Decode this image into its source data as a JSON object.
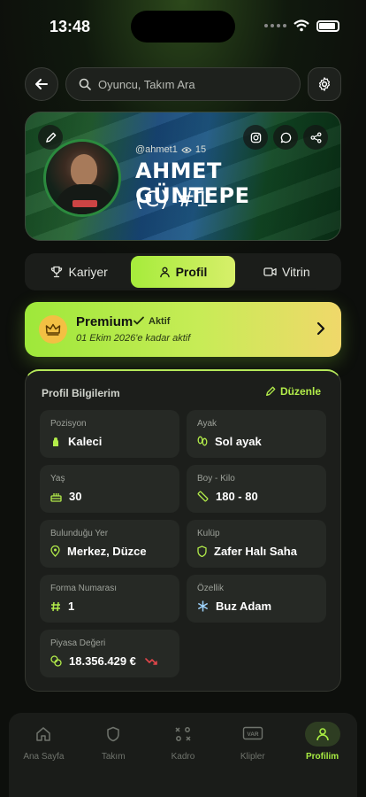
{
  "status_bar": {
    "time": "13:48"
  },
  "search": {
    "placeholder": "Oyuncu, Takım Ara"
  },
  "profile": {
    "handle": "@ahmet1",
    "views": "15",
    "name": "AHMET GÜNTEPE",
    "number_line": "(C) #1"
  },
  "tabs": [
    {
      "label": "Kariyer",
      "icon": "trophy-icon"
    },
    {
      "label": "Profil",
      "icon": "user-icon",
      "active": true
    },
    {
      "label": "Vitrin",
      "icon": "video-icon"
    }
  ],
  "premium": {
    "title": "Premium",
    "status": "Aktif",
    "subtitle": "01 Ekim 2026'e kadar aktif"
  },
  "profile_info": {
    "title": "Profil Bilgilerim",
    "edit_label": "Düzenle",
    "fields": [
      {
        "label": "Pozisyon",
        "value": "Kaleci",
        "icon": "goalkeeper-icon"
      },
      {
        "label": "Ayak",
        "value": "Sol ayak",
        "icon": "foot-icon"
      },
      {
        "label": "Yaş",
        "value": "30",
        "icon": "cake-icon"
      },
      {
        "label": "Boy - Kilo",
        "value": "180 - 80",
        "icon": "ruler-icon"
      },
      {
        "label": "Bulunduğu Yer",
        "value": "Merkez, Düzce",
        "icon": "location-pin-icon"
      },
      {
        "label": "Kulüp",
        "value": "Zafer Halı Saha",
        "icon": "shield-icon"
      },
      {
        "label": "Forma Numarası",
        "value": "1",
        "icon": "hash-icon"
      },
      {
        "label": "Özellik",
        "value": "Buz Adam",
        "icon": "snowflake-icon"
      },
      {
        "label": "Piyasa Değeri",
        "value": "18.356.429 €",
        "icon": "coins-icon",
        "trend": "down"
      }
    ]
  },
  "bottom_nav": [
    {
      "label": "Ana Sayfa",
      "icon": "home-icon"
    },
    {
      "label": "Takım",
      "icon": "shield-icon"
    },
    {
      "label": "Kadro",
      "icon": "tactics-icon"
    },
    {
      "label": "Klipler",
      "icon": "var-icon"
    },
    {
      "label": "Profilim",
      "icon": "user-icon",
      "active": true
    }
  ],
  "colors": {
    "accent": "#a6ec3b",
    "premium_gold": "#f0d86a",
    "trend_down": "#e0454a",
    "background": "#0d0f0c"
  }
}
